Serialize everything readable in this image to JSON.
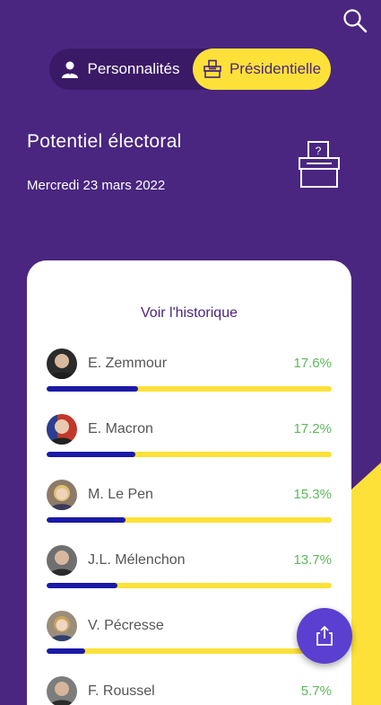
{
  "header": {
    "search_icon": "search-icon"
  },
  "tabs": [
    {
      "label": "Personnalités",
      "icon": "person-icon",
      "active": false
    },
    {
      "label": "Présidentielle",
      "icon": "ballot-box-icon",
      "active": true
    }
  ],
  "page": {
    "title": "Potentiel électoral",
    "date": "Mercredi 23 mars 2022",
    "illustration": "ballot-box-icon"
  },
  "card": {
    "history_link": "Voir l'historique",
    "candidates": [
      {
        "name": "E. Zemmour",
        "percent": "17.6%",
        "value": 17.6
      },
      {
        "name": "E. Macron",
        "percent": "17.2%",
        "value": 17.2
      },
      {
        "name": "M. Le Pen",
        "percent": "15.3%",
        "value": 15.3
      },
      {
        "name": "J.L. Mélenchon",
        "percent": "13.7%",
        "value": 13.7
      },
      {
        "name": "V. Pécresse",
        "percent": "",
        "value": 7.5
      },
      {
        "name": "F. Roussel",
        "percent": "5.7%",
        "value": 5.7
      }
    ]
  },
  "fab": {
    "icon": "share-icon"
  },
  "colors": {
    "background": "#4a2680",
    "accent_yellow": "#fde138",
    "bar_fill": "#1a1aa8",
    "percent_green": "#5bb85b",
    "fab": "#5a3fd0"
  }
}
